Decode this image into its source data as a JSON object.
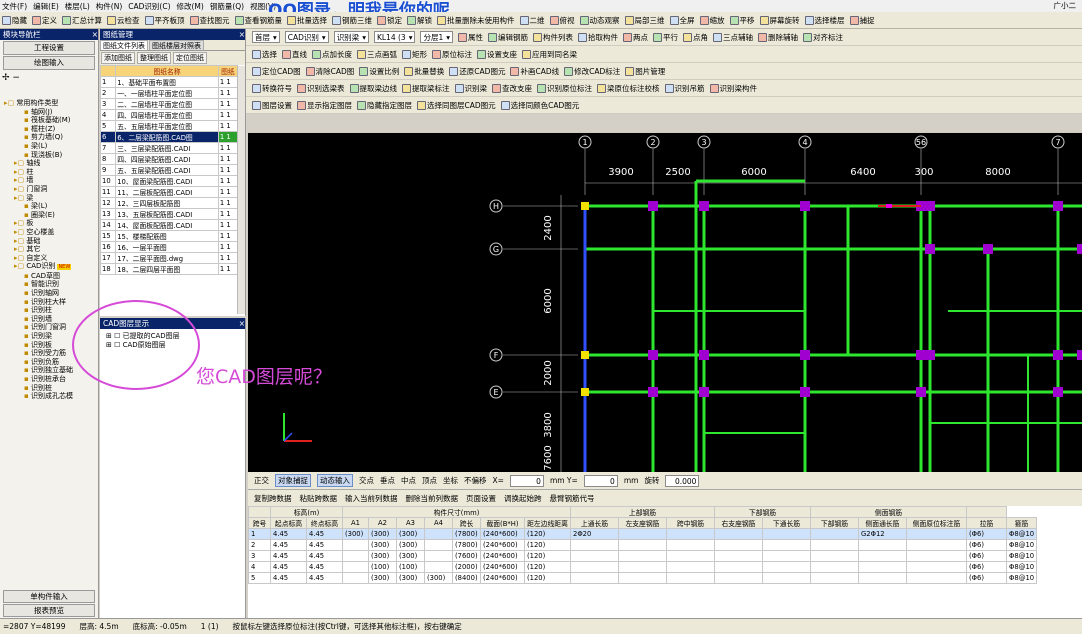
{
  "menu": [
    "文件(F)",
    "编辑(E)",
    "楼层(L)",
    "构件(N)",
    "CAD识别(C)",
    "修改(M)",
    "钢筋量(Q)",
    "视图(V)"
  ],
  "overlay_title": "QQ图录，明我是你的呢",
  "user": "广小二",
  "toolbar1": [
    "隐藏",
    "定义",
    "汇总计算",
    "云检查",
    "平齐板顶",
    "查找图元",
    "查看钢筋量",
    "批量选择",
    "钢筋三维",
    "锁定",
    "解锁",
    "批量删除未使用构件",
    "二维",
    "俯视",
    "动态观察",
    "局部三维",
    "全屏",
    "缩放",
    "平移",
    "屏幕旋转",
    "选择楼层",
    "捕捉"
  ],
  "left_panel": {
    "title": "模块导航栏",
    "btn_engineering": "工程设置",
    "btn_drawing_input": "绘图输入",
    "tree": [
      "常用构件类型",
      "轴网(J)",
      "筏板基础(M)",
      "框柱(Z)",
      "剪力墙(Q)",
      "梁(L)",
      "现浇板(B)",
      "轴线",
      "柱",
      "墙",
      "门窗洞",
      "梁",
      "梁(L)",
      "圈梁(E)",
      "板",
      "空心楼盖",
      "基础",
      "其它",
      "自定义",
      "CAD识别",
      "CAD草图",
      "智能识别",
      "识别轴网",
      "识别柱大样",
      "识别柱",
      "识别墙",
      "识别门窗洞",
      "识别梁",
      "识别板",
      "识别受力筋",
      "识别负筋",
      "识别独立基础",
      "识别桩承台",
      "识别桩",
      "识别成孔芯模"
    ],
    "new_badge": "NEW",
    "btn_single": "单构件输入",
    "btn_report": "报表预览"
  },
  "drawing_panel": {
    "title": "图纸管理",
    "tabs": [
      "图纸文件列表",
      "图纸楼层对照表"
    ],
    "buttons": [
      "添加图纸",
      "整理图纸",
      "定位图纸"
    ],
    "col_name": "图纸名称",
    "col_group": "图纸",
    "rows": [
      [
        "1",
        "1、基础平面布置图",
        "1 1"
      ],
      [
        "2",
        "一、一层墙柱平面定位图",
        "1 1"
      ],
      [
        "3",
        "二、二层墙柱平面定位图",
        "1 1"
      ],
      [
        "4",
        "四、四层墙柱平面定位图",
        "1 1"
      ],
      [
        "5",
        "五、五层墙柱平面定位图",
        "1 1"
      ],
      [
        "6",
        "6、二层梁配筋图.CAD图",
        "1 1"
      ],
      [
        "7",
        "三、三层梁配筋图.CADI",
        "1 1"
      ],
      [
        "8",
        "四、四层梁配筋图.CADI",
        "1 1"
      ],
      [
        "9",
        "五、五层梁配筋图.CADI",
        "1 1"
      ],
      [
        "10",
        "10、屋面梁配筋图.CADI",
        "1 1"
      ],
      [
        "11",
        "11、二层板配筋图.CADI",
        "1 1"
      ],
      [
        "12",
        "12、三四层板配筋图",
        "1 1"
      ],
      [
        "13",
        "13、五层板配筋图.CADI",
        "1 1"
      ],
      [
        "14",
        "14、屋面板配筋图.CADI",
        "1 1"
      ],
      [
        "15",
        "15、楼梯配筋图",
        "1 1"
      ],
      [
        "16",
        "16、一层平面图",
        "1 1"
      ],
      [
        "17",
        "17、二层平面图.dwg",
        "1 1"
      ],
      [
        "18",
        "18、二层四层平面图",
        "1 1"
      ]
    ]
  },
  "layer_panel": {
    "title": "CAD图层显示",
    "items": [
      "已提取的CAD图层",
      "CAD原始图层"
    ]
  },
  "props": {
    "row1": [
      "首层",
      "CAD识别",
      "识别梁",
      "KL14 (3",
      "分层1",
      "属性",
      "编辑钢筋",
      "构件列表",
      "拾取构件",
      "两点",
      "平行",
      "点角",
      "三点辅轴",
      "删除辅轴",
      "对齐标注"
    ],
    "row2": [
      "选择",
      "直线",
      "点加长度",
      "三点画弧",
      "矩形",
      "原位标注",
      "设置支座",
      "应用到同名梁"
    ],
    "row3": [
      "定位CAD图",
      "清除CAD图",
      "设置比例",
      "批量替换",
      "还原CAD图元",
      "补画CAD线",
      "修改CAD标注",
      "图片管理"
    ],
    "row4": [
      "转换符号",
      "识别选梁表",
      "提取梁边线",
      "提取梁标注",
      "识别梁",
      "查改支座",
      "识别原位标注",
      "梁原位标注校核",
      "识别吊筋",
      "识别梁构件"
    ],
    "row5": [
      "图层设置",
      "显示指定图层",
      "隐藏指定图层",
      "选择同图层CAD图元",
      "选择同颜色CAD图元"
    ]
  },
  "canvas": {
    "axis_top": [
      "1",
      "2",
      "3",
      "4",
      "56",
      "7"
    ],
    "dims_top": [
      "3900",
      "2500",
      "6000",
      "6400",
      "300",
      "8000"
    ],
    "axis_left": [
      "H",
      "G",
      "F",
      "E"
    ],
    "dims_left": [
      "2400",
      "6000",
      "2000",
      "3800",
      "7600"
    ]
  },
  "snapbar": {
    "items": [
      "正交",
      "对象捕捉",
      "动态输入",
      "交点",
      "垂点",
      "中点",
      "顶点",
      "坐标",
      "不偏移"
    ],
    "x_label": "X=",
    "x_value": "0",
    "y_label": "mm Y=",
    "y_value": "0",
    "unit": "mm",
    "rotate_label": "旋转",
    "rotate_value": "0.000"
  },
  "gridbar": [
    "复制跨数据",
    "粘贴跨数据",
    "输入当前列数据",
    "删除当前列数据",
    "页面设置",
    "调换起始跨",
    "悬臂钢筋代号"
  ],
  "grid": {
    "headers": [
      "跨号",
      "起点标高",
      "终点标高",
      "A1",
      "A2",
      "A3",
      "A4",
      "跨长",
      "截面(B*H)",
      "距左边线距离",
      "上通长筋",
      "左支座钢筋",
      "跨中钢筋",
      "右支座钢筋",
      "下通长筋",
      "下部钢筋",
      "侧面通长筋",
      "侧面原位标注筋",
      "拉筋",
      "箍筋"
    ],
    "group_headers": [
      "标高(m)",
      "构件尺寸(mm)",
      "上部钢筋",
      "下部钢筋",
      "侧面钢筋"
    ],
    "rows": [
      [
        "1",
        "4.45",
        "4.45",
        "(300)",
        "(300)",
        "(300)",
        "",
        "(7800)",
        "(240*600)",
        "(120)",
        "2Φ20",
        "",
        "",
        "",
        "",
        "",
        "G2Φ12",
        "",
        "(Φ6)",
        "Φ8@10"
      ],
      [
        "2",
        "4.45",
        "4.45",
        "",
        "(300)",
        "(300)",
        "",
        "(7800)",
        "(240*600)",
        "(120)",
        "",
        "",
        "",
        "",
        "",
        "",
        "",
        "",
        "(Φ6)",
        "Φ8@10"
      ],
      [
        "3",
        "4.45",
        "4.45",
        "",
        "(300)",
        "(300)",
        "",
        "(7600)",
        "(240*600)",
        "(120)",
        "",
        "",
        "",
        "",
        "",
        "",
        "",
        "",
        "(Φ6)",
        "Φ8@10"
      ],
      [
        "4",
        "4.45",
        "4.45",
        "",
        "(100)",
        "(100)",
        "",
        "(2000)",
        "(240*600)",
        "(120)",
        "",
        "",
        "",
        "",
        "",
        "",
        "",
        "",
        "(Φ6)",
        "Φ8@10"
      ],
      [
        "5",
        "4.45",
        "4.45",
        "",
        "(300)",
        "(300)",
        "(300)",
        "(8400)",
        "(240*600)",
        "(120)",
        "",
        "",
        "",
        "",
        "",
        "",
        "",
        "",
        "(Φ6)",
        "Φ8@10"
      ]
    ]
  },
  "status": [
    "=2807 Y=48199",
    "层高: 4.5m",
    "底标高: -0.05m",
    "1 (1)",
    "按鼠标左键选择原位标注(按Ctrl键，可选择其他标注框)，按右键确定"
  ],
  "annotation": "您CAD图层呢？"
}
